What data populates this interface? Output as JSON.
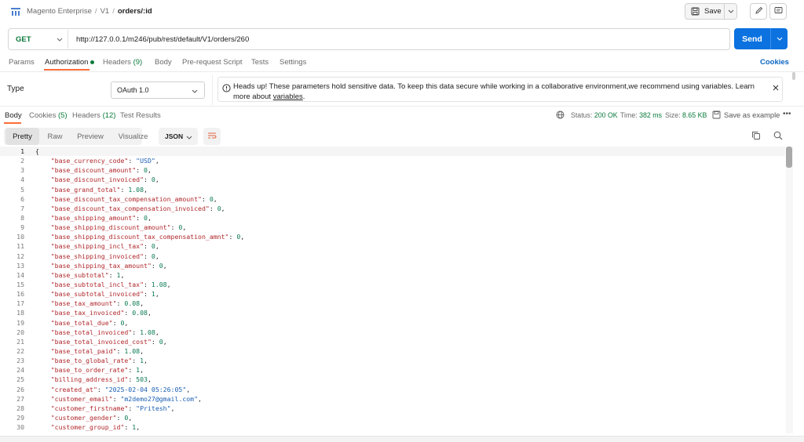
{
  "header": {
    "breadcrumb": [
      "Magento Enterprise",
      "V1",
      "orders/:id"
    ],
    "save_label": "Save"
  },
  "request": {
    "method": "GET",
    "url": "http://127.0.0.1/m246/pub/rest/default/V1/orders/260",
    "send_label": "Send"
  },
  "request_tabs": [
    {
      "label": "Params"
    },
    {
      "label": "Authorization",
      "active": true,
      "dot": true
    },
    {
      "label": "Headers",
      "count": "(9)"
    },
    {
      "label": "Body"
    },
    {
      "label": "Pre-request Script"
    },
    {
      "label": "Tests"
    },
    {
      "label": "Settings"
    }
  ],
  "cookies_link": "Cookies",
  "auth": {
    "type_label": "Type",
    "type_value": "OAuth 1.0",
    "notice_text": "Heads up! These parameters hold sensitive data. To keep this data secure while working in a collaborative environment,we recommend using variables. Learn more about",
    "notice_link": "variables",
    "notice_end": "."
  },
  "response_tabs": [
    {
      "label": "Body",
      "active": true
    },
    {
      "label": "Cookies",
      "count": "(5)"
    },
    {
      "label": "Headers",
      "count": "(12)"
    },
    {
      "label": "Test Results"
    }
  ],
  "response_meta": {
    "status_label": "Status:",
    "status_value": "200 OK",
    "time_label": "Time:",
    "time_value": "382 ms",
    "size_label": "Size:",
    "size_value": "8.65 KB",
    "save_example": "Save as example"
  },
  "view_modes": [
    "Pretty",
    "Raw",
    "Preview",
    "Visualize"
  ],
  "active_view": "Pretty",
  "format": "JSON",
  "colors": {
    "accent": "#ff6c37",
    "send": "#0b72e0",
    "method_get": "#0c7a3c",
    "json_key": "#b0282c",
    "json_string": "#1a5fb4",
    "json_number": "#0b7a52"
  },
  "code_lines": [
    {
      "n": "1",
      "t": "open",
      "text": "{"
    },
    {
      "n": "2",
      "key": "base_currency_code",
      "vtype": "s",
      "value": "\"USD\""
    },
    {
      "n": "3",
      "key": "base_discount_amount",
      "vtype": "n",
      "value": "0"
    },
    {
      "n": "4",
      "key": "base_discount_invoiced",
      "vtype": "n",
      "value": "0"
    },
    {
      "n": "5",
      "key": "base_grand_total",
      "vtype": "n",
      "value": "1.08"
    },
    {
      "n": "6",
      "key": "base_discount_tax_compensation_amount",
      "vtype": "n",
      "value": "0"
    },
    {
      "n": "7",
      "key": "base_discount_tax_compensation_invoiced",
      "vtype": "n",
      "value": "0"
    },
    {
      "n": "8",
      "key": "base_shipping_amount",
      "vtype": "n",
      "value": "0"
    },
    {
      "n": "9",
      "key": "base_shipping_discount_amount",
      "vtype": "n",
      "value": "0"
    },
    {
      "n": "10",
      "key": "base_shipping_discount_tax_compensation_amnt",
      "vtype": "n",
      "value": "0"
    },
    {
      "n": "11",
      "key": "base_shipping_incl_tax",
      "vtype": "n",
      "value": "0"
    },
    {
      "n": "12",
      "key": "base_shipping_invoiced",
      "vtype": "n",
      "value": "0"
    },
    {
      "n": "13",
      "key": "base_shipping_tax_amount",
      "vtype": "n",
      "value": "0"
    },
    {
      "n": "14",
      "key": "base_subtotal",
      "vtype": "n",
      "value": "1"
    },
    {
      "n": "15",
      "key": "base_subtotal_incl_tax",
      "vtype": "n",
      "value": "1.08"
    },
    {
      "n": "16",
      "key": "base_subtotal_invoiced",
      "vtype": "n",
      "value": "1"
    },
    {
      "n": "17",
      "key": "base_tax_amount",
      "vtype": "n",
      "value": "0.08"
    },
    {
      "n": "18",
      "key": "base_tax_invoiced",
      "vtype": "n",
      "value": "0.08"
    },
    {
      "n": "19",
      "key": "base_total_due",
      "vtype": "n",
      "value": "0"
    },
    {
      "n": "20",
      "key": "base_total_invoiced",
      "vtype": "n",
      "value": "1.08"
    },
    {
      "n": "21",
      "key": "base_total_invoiced_cost",
      "vtype": "n",
      "value": "0"
    },
    {
      "n": "22",
      "key": "base_total_paid",
      "vtype": "n",
      "value": "1.08"
    },
    {
      "n": "23",
      "key": "base_to_global_rate",
      "vtype": "n",
      "value": "1"
    },
    {
      "n": "24",
      "key": "base_to_order_rate",
      "vtype": "n",
      "value": "1"
    },
    {
      "n": "25",
      "key": "billing_address_id",
      "vtype": "n",
      "value": "503"
    },
    {
      "n": "26",
      "key": "created_at",
      "vtype": "s",
      "value": "\"2025-02-04 05:26:05\""
    },
    {
      "n": "27",
      "key": "customer_email",
      "vtype": "s",
      "value": "\"m2demo27@gmail.com\""
    },
    {
      "n": "28",
      "key": "customer_firstname",
      "vtype": "s",
      "value": "\"Pritesh\""
    },
    {
      "n": "29",
      "key": "customer_gender",
      "vtype": "n",
      "value": "0"
    },
    {
      "n": "30",
      "key": "customer_group_id",
      "vtype": "n",
      "value": "1"
    }
  ]
}
